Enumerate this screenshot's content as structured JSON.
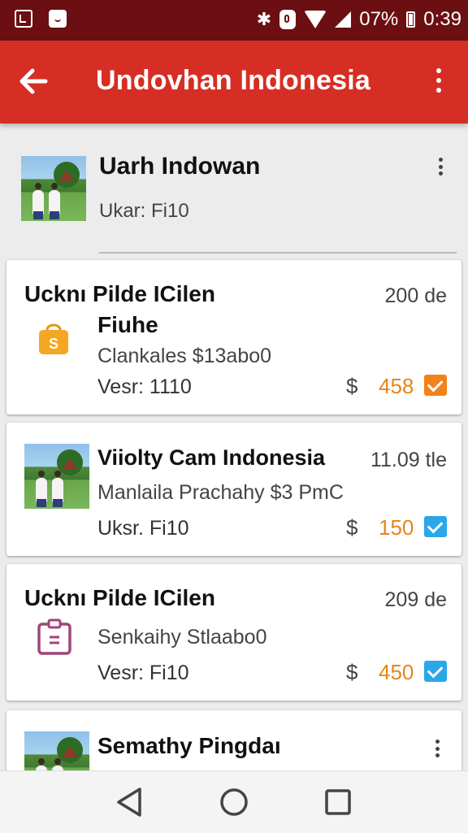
{
  "status_bar": {
    "battery": "07%",
    "time": "0:39"
  },
  "app_bar": {
    "title": "Undovhan Indonesia"
  },
  "header": {
    "name": "Uarh Indowan",
    "subtitle": "Ukar: Fi10"
  },
  "cards": [
    {
      "title": "Ucknı Pilde ICilen",
      "title2": "Fiuhe",
      "right_text": "200 de",
      "subtitle": "Clankales $13abo0",
      "meta": "Vesr: 1110",
      "currency": "$",
      "price": "458",
      "price_color": "#e8841a",
      "check_color": "#f2821c",
      "icon": "shopping-bag-icon"
    },
    {
      "title": "Viiolty Cam Indonesia",
      "right_text": "11.09 tle",
      "subtitle": "Manlaila Prachahy $3 PmC",
      "meta": "Uksr. Fi10",
      "currency": "$",
      "price": "150",
      "price_color": "#e8841a",
      "check_color": "#2aa7e8"
    },
    {
      "title": "Ucknı Pilde ICilen",
      "right_text": "209 de",
      "subtitle": "Senkaihy Stlaabo0",
      "meta": "Vesr: Fi10",
      "currency": "$",
      "price": "450",
      "price_color": "#e8841a",
      "check_color": "#2aa7e8",
      "icon": "clipboard-icon"
    },
    {
      "title": "Semathy Pingdaı"
    }
  ]
}
